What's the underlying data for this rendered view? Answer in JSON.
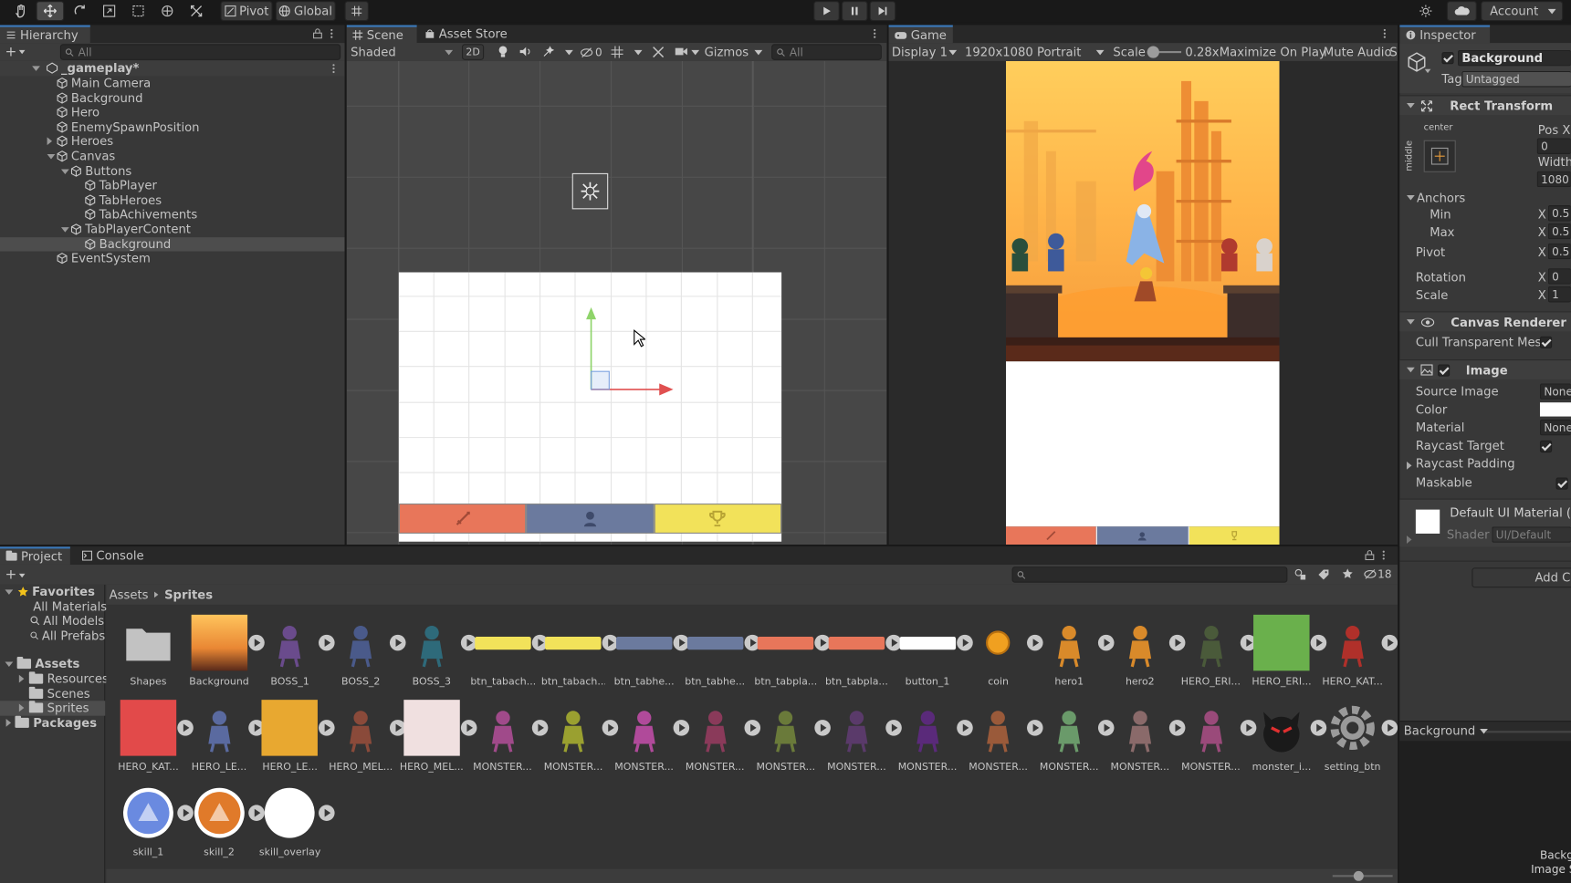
{
  "toolbar": {
    "pivot_label": "Pivot",
    "global_label": "Global",
    "account_label": "Account"
  },
  "hierarchy": {
    "tab_label": "Hierarchy",
    "search_placeholder": "All",
    "scene_name": "_gameplay*",
    "items": [
      {
        "label": "Main Camera"
      },
      {
        "label": "Background"
      },
      {
        "label": "Hero"
      },
      {
        "label": "EnemySpawnPosition"
      },
      {
        "label": "Heroes"
      },
      {
        "label": "Canvas"
      },
      {
        "label": "Buttons"
      },
      {
        "label": "TabPlayer"
      },
      {
        "label": "TabHeroes"
      },
      {
        "label": "TabAchivements"
      },
      {
        "label": "TabPlayerContent"
      },
      {
        "label": "Background"
      },
      {
        "label": "EventSystem"
      }
    ]
  },
  "scene": {
    "tab_scene": "Scene",
    "tab_asset_store": "Asset Store",
    "shading_mode": "Shaded",
    "mode_2d": "2D",
    "hidden_count": "0",
    "gizmos_label": "Gizmos",
    "search_placeholder": "All"
  },
  "game": {
    "tab_label": "Game",
    "display": "Display 1",
    "resolution": "1920x1080 Portrait",
    "scale_label": "Scale",
    "scale_value": "0.28x",
    "maximize_label": "Maximize On Play",
    "mute_label": "Mute Audio",
    "stats_label": "S"
  },
  "inspector": {
    "tab_label": "Inspector",
    "object_name": "Background",
    "tag_label": "Tag",
    "tag_value": "Untagged",
    "rect_transform": {
      "title": "Rect Transform",
      "anchor_h": "center",
      "anchor_v": "middle",
      "pos_x_label": "Pos X",
      "pos_x_value": "0",
      "width_label": "Width",
      "width_value": "1080",
      "anchors_label": "Anchors",
      "min_label": "Min",
      "min_x": "0.5",
      "max_label": "Max",
      "max_x": "0.5",
      "pivot_label": "Pivot",
      "pivot_x": "0.5",
      "rotation_label": "Rotation",
      "rotation_x": "0",
      "scale_label": "Scale",
      "scale_x": "1",
      "x_label": "X"
    },
    "canvas_renderer": {
      "title": "Canvas Renderer",
      "cull_label": "Cull Transparent Mesh"
    },
    "image": {
      "title": "Image",
      "source_label": "Source Image",
      "source_value": "None",
      "color_label": "Color",
      "material_label": "Material",
      "material_value": "None",
      "raycast_target_label": "Raycast Target",
      "raycast_padding_label": "Raycast Padding",
      "maskable_label": "Maskable"
    },
    "material": {
      "name": "Default UI Material (M",
      "shader_label": "Shader",
      "shader_value": "UI/Default"
    },
    "add_component": "Add Co",
    "preview_dropdown": "Background",
    "preview_info_1": "Backg",
    "preview_info_2": "Image S"
  },
  "project": {
    "tab_project": "Project",
    "tab_console": "Console",
    "hidden_count": "18",
    "favorites_label": "Favorites",
    "favorites": [
      {
        "label": "All Materials"
      },
      {
        "label": "All Models"
      },
      {
        "label": "All Prefabs"
      }
    ],
    "assets_label": "Assets",
    "folders": [
      {
        "label": "Resources"
      },
      {
        "label": "Scenes"
      },
      {
        "label": "Sprites"
      }
    ],
    "packages_label": "Packages",
    "breadcrumb_root": "Assets",
    "breadcrumb_current": "Sprites",
    "assets": [
      {
        "name": "Shapes"
      },
      {
        "name": "Background"
      },
      {
        "name": "BOSS_1"
      },
      {
        "name": "BOSS_2"
      },
      {
        "name": "BOSS_3"
      },
      {
        "name": "btn_tabach..."
      },
      {
        "name": "btn_tabach..."
      },
      {
        "name": "btn_tabhe..."
      },
      {
        "name": "btn_tabhe..."
      },
      {
        "name": "btn_tabpla..."
      },
      {
        "name": "btn_tabpla..."
      },
      {
        "name": "button_1"
      },
      {
        "name": "coin"
      },
      {
        "name": "hero1"
      },
      {
        "name": "hero2"
      },
      {
        "name": "HERO_ERI..."
      },
      {
        "name": "HERO_ERI..."
      },
      {
        "name": "HERO_KAT..."
      },
      {
        "name": "HERO_KAT..."
      },
      {
        "name": "HERO_LE..."
      },
      {
        "name": "HERO_LE..."
      },
      {
        "name": "HERO_MEL..."
      },
      {
        "name": "HERO_MEL..."
      },
      {
        "name": "MONSTER..."
      },
      {
        "name": "MONSTER..."
      },
      {
        "name": "MONSTER..."
      },
      {
        "name": "MONSTER..."
      },
      {
        "name": "MONSTER..."
      },
      {
        "name": "MONSTER..."
      },
      {
        "name": "MONSTER..."
      },
      {
        "name": "MONSTER..."
      },
      {
        "name": "MONSTER..."
      },
      {
        "name": "MONSTER..."
      },
      {
        "name": "MONSTER..."
      },
      {
        "name": "monster_i..."
      },
      {
        "name": "setting_btn"
      },
      {
        "name": "skill_1"
      },
      {
        "name": "skill_2"
      },
      {
        "name": "skill_overlay"
      }
    ]
  },
  "colors": {
    "tab_red": "#e8765a",
    "tab_blue": "#6b7a9e",
    "tab_yellow": "#f2e25a",
    "accent": "#3a79bb"
  }
}
